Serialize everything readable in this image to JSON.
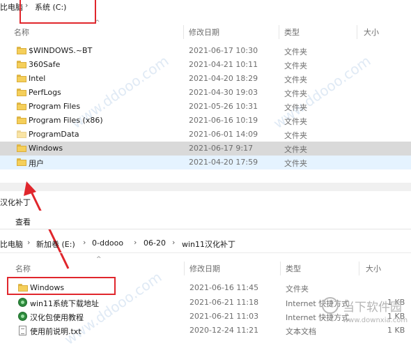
{
  "top": {
    "breadcrumb": [
      "比电脑",
      "系统 (C:)"
    ],
    "columns": {
      "name": "名称",
      "date": "修改日期",
      "type": "类型",
      "size": "大小"
    },
    "rows": [
      {
        "name": "$WINDOWS.~BT",
        "date": "2021-06-17 10:30",
        "type": "文件夹"
      },
      {
        "name": "360Safe",
        "date": "2021-04-21 10:11",
        "type": "文件夹"
      },
      {
        "name": "Intel",
        "date": "2021-04-20 18:29",
        "type": "文件夹"
      },
      {
        "name": "PerfLogs",
        "date": "2021-04-30 19:03",
        "type": "文件夹"
      },
      {
        "name": "Program Files",
        "date": "2021-05-26 10:31",
        "type": "文件夹"
      },
      {
        "name": "Program Files (x86)",
        "date": "2021-06-16 10:19",
        "type": "文件夹"
      },
      {
        "name": "ProgramData",
        "date": "2021-06-01 14:09",
        "type": "文件夹"
      },
      {
        "name": "Windows",
        "date": "2021-06-17 9:17",
        "type": "文件夹"
      },
      {
        "name": "用户",
        "date": "2021-04-20 17:59",
        "type": "文件夹"
      }
    ]
  },
  "bottom": {
    "window_title": "汉化补丁",
    "ribbon_tab": "查看",
    "breadcrumb": [
      "比电脑",
      "新加卷 (E:)",
      "0-ddooo",
      "06-20",
      "win11汉化补丁"
    ],
    "columns": {
      "name": "名称",
      "date": "修改日期",
      "type": "类型",
      "size": "大小"
    },
    "rows": [
      {
        "name": "Windows",
        "date": "2021-06-16 11:45",
        "type": "文件夹",
        "size": "",
        "icon": "folder-icon"
      },
      {
        "name": "win11系统下载地址",
        "date": "2021-06-21 11:18",
        "type": "Internet 快捷方式",
        "size": "1 KB",
        "icon": "internet-shortcut-icon"
      },
      {
        "name": "汉化包使用教程",
        "date": "2021-06-21 11:03",
        "type": "Internet 快捷方式",
        "size": "1 KB",
        "icon": "internet-shortcut-icon"
      },
      {
        "name": "使用前说明.txt",
        "date": "2020-12-24 11:21",
        "type": "文本文档",
        "size": "1 KB",
        "icon": "text-file-icon"
      }
    ]
  },
  "watermark": {
    "site": "当下软件园",
    "url": "www.downxia.com",
    "faint": "www.ddooo.com"
  },
  "colors": {
    "selected": "#d9d9d9",
    "hover": "#e5f3ff",
    "annotation_red": "#e0262c"
  }
}
